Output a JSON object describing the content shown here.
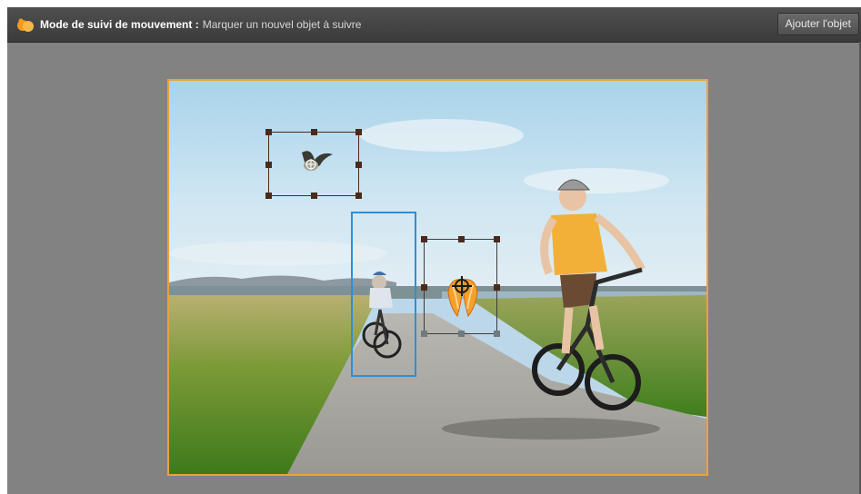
{
  "header": {
    "mode_title": "Mode de suivi de mouvement :",
    "mode_subtitle": "Marquer un nouvel objet à suivre",
    "add_object_button": "Ajouter l'objet"
  },
  "colors": {
    "viewer_border": "#e8a437",
    "selection": "#2d8fd6",
    "handle": "#4a2a1c"
  },
  "icons": {
    "logo": "premiere-elements-logo-icon",
    "tracked_bird": "bird-graphic-icon",
    "tracked_wings": "butterfly-wings-graphic-icon",
    "crosshair": "crosshair-icon"
  }
}
